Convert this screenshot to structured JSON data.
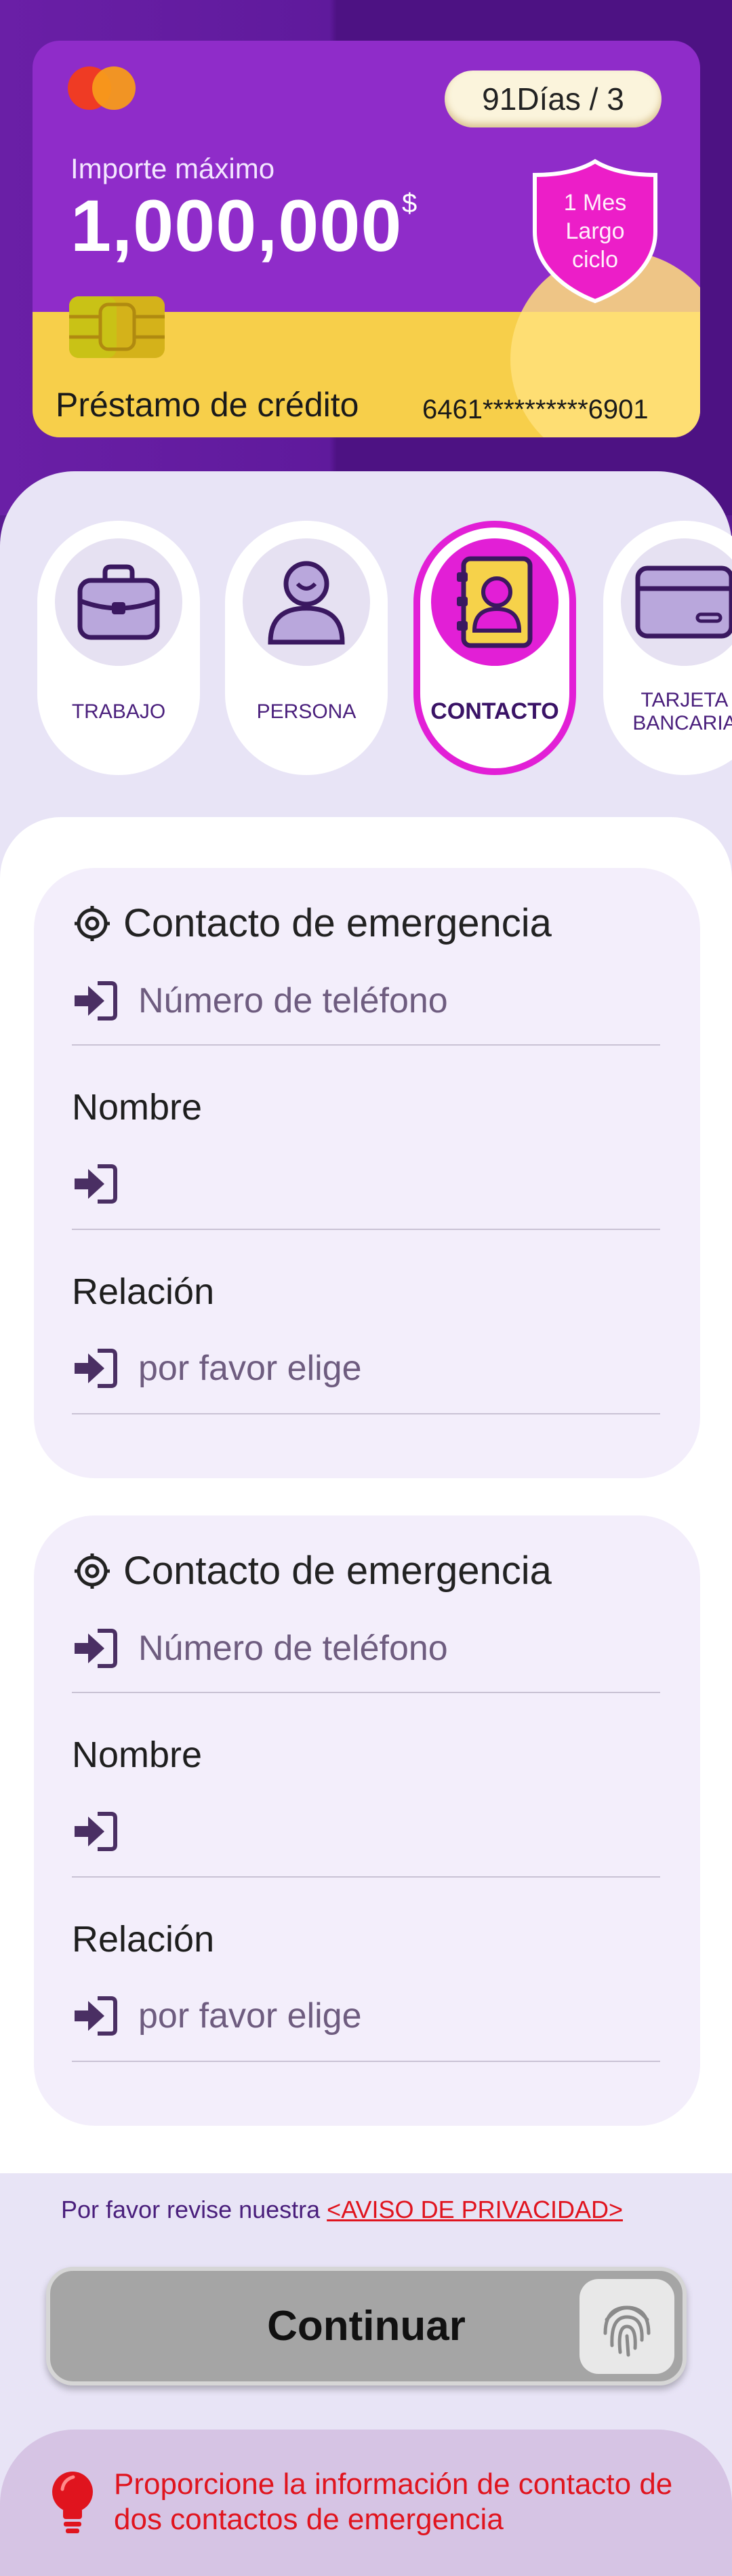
{
  "card": {
    "term": "91Días / 3",
    "amount_label": "Importe máximo",
    "amount": "1,000,000",
    "currency": "$",
    "badge": [
      "1 Mes",
      "Largo",
      "ciclo"
    ],
    "loan_title": "Préstamo de crédito",
    "card_number": "6461**********6901"
  },
  "steps": [
    {
      "label": "TRABAJO",
      "icon": "briefcase-icon",
      "active": false
    },
    {
      "label": "PERSONA",
      "icon": "person-icon",
      "active": false
    },
    {
      "label": "CONTACTO",
      "icon": "contact-book-icon",
      "active": true
    },
    {
      "label_line1": "TARJETA",
      "label_line2": "BANCARIA",
      "icon": "bank-card-icon",
      "active": false
    }
  ],
  "contacts": [
    {
      "title": "Contacto de emergencia",
      "phone_placeholder": "Número de teléfono",
      "name_label": "Nombre",
      "name_value": "",
      "relation_label": "Relación",
      "relation_placeholder": "por favor elige"
    },
    {
      "title": "Contacto de emergencia",
      "phone_placeholder": "Número de teléfono",
      "name_label": "Nombre",
      "name_value": "",
      "relation_label": "Relación",
      "relation_placeholder": "por favor elige"
    }
  ],
  "privacy": {
    "text": "Por favor revise nuestra ",
    "link": "<AVISO DE PRIVACIDAD>"
  },
  "continue_button": "Continuar",
  "notice": "Proporcione la información de contacto de dos contactos de emergencia",
  "colors": {
    "accent": "#e21fd6",
    "purple": "#8f2cc9",
    "yellow": "#f7cf4a",
    "warning": "#e0141e"
  }
}
